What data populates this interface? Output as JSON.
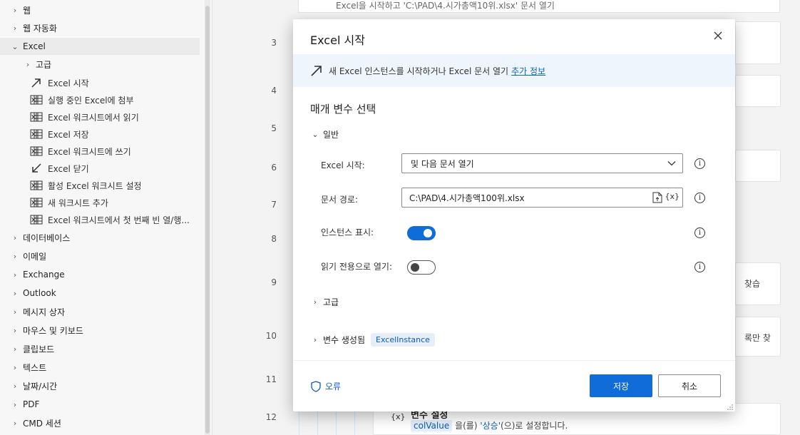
{
  "sidebar": {
    "groups_top": [
      {
        "label": "웹"
      },
      {
        "label": "웹 자동화"
      }
    ],
    "excel": {
      "label": "Excel",
      "sub_label": "고급",
      "items": [
        {
          "label": "Excel 시작",
          "icon": "arrow-up-right-icon"
        },
        {
          "label": "실행 중인 Excel에 첨부",
          "icon": "excel-sheet-icon"
        },
        {
          "label": "Excel 워크시트에서 읽기",
          "icon": "excel-sheet-icon"
        },
        {
          "label": "Excel 저장",
          "icon": "excel-sheet-icon"
        },
        {
          "label": "Excel 워크시트에 쓰기",
          "icon": "excel-sheet-icon"
        },
        {
          "label": "Excel 닫기",
          "icon": "arrow-down-left-icon"
        },
        {
          "label": "활성 Excel 워크시트 설정",
          "icon": "excel-sheet-icon"
        },
        {
          "label": "새 워크시트 추가",
          "icon": "excel-sheet-icon"
        },
        {
          "label": "Excel 워크시트에서 첫 번째 빈 열/행...",
          "icon": "excel-sheet-icon"
        }
      ]
    },
    "groups_bottom": [
      {
        "label": "데이터베이스"
      },
      {
        "label": "이메일"
      },
      {
        "label": "Exchange"
      },
      {
        "label": "Outlook"
      },
      {
        "label": "메시지 상자"
      },
      {
        "label": "마우스 및 키보드"
      },
      {
        "label": "클립보드"
      },
      {
        "label": "텍스트"
      },
      {
        "label": "날짜/시간"
      },
      {
        "label": "PDF"
      },
      {
        "label": "CMD 세션"
      }
    ]
  },
  "canvas": {
    "line_numbers": [
      "3",
      "4",
      "5",
      "6",
      "7",
      "8",
      "9",
      "10",
      "11",
      "12"
    ],
    "top_step_text": "Excel을 시작하고 'C:\\PAD\\4.시가총액10위.xlsx' 문서 열기",
    "right_snippet_1": "찾습",
    "right_snippet_2": "록만 찾",
    "bottom_step": {
      "title": "변수 설정",
      "var_name": "colValue",
      "mid": "을(를)",
      "value": "'상승'",
      "tail": "(으)로 설정합니다."
    }
  },
  "modal": {
    "title": "Excel 시작",
    "banner_text": "새 Excel 인스턴스를 시작하거나 Excel 문서 열기",
    "banner_link": "추가 정보",
    "section_title": "매개 변수 선택",
    "general_label": "일반",
    "fields": {
      "launch_label": "Excel 시작:",
      "launch_value": "및 다음 문서 열기",
      "path_label": "문서 경로:",
      "path_value": "C:\\PAD\\4.시가총액100위.xlsx",
      "path_var_icon": "{x}",
      "visible_label": "인스턴스 표시:",
      "visible_on": true,
      "readonly_label": "읽기 전용으로 열기:",
      "readonly_on": false
    },
    "advanced_label": "고급",
    "produced_label": "변수 생성됨",
    "produced_var": "ExcelInstance",
    "error_label": "오류",
    "save_label": "저장",
    "cancel_label": "취소"
  }
}
